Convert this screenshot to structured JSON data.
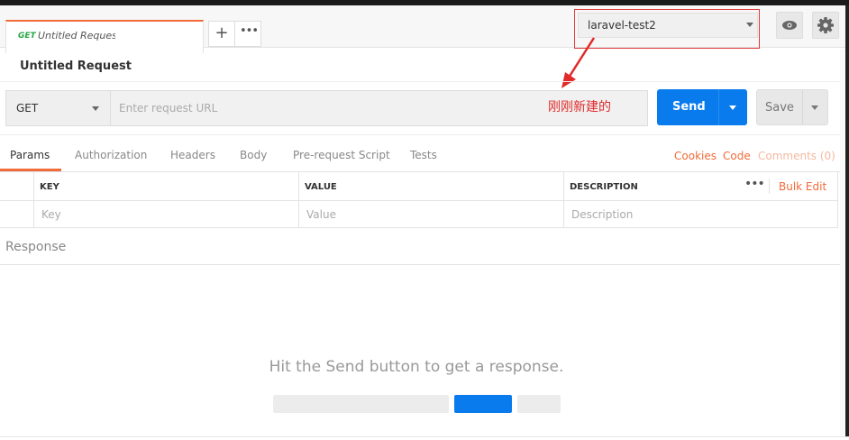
{
  "tab": {
    "method": "GET",
    "name": "Untitled Request"
  },
  "tab_controls": {
    "add": "+",
    "more": "•••"
  },
  "environment": {
    "selected": "laravel-test2"
  },
  "request": {
    "title": "Untitled Request",
    "method": "GET",
    "url_placeholder": "Enter request URL",
    "url_value": ""
  },
  "annotation": {
    "text": "刚刚新建的",
    "color": "#e12a2a"
  },
  "buttons": {
    "send": "Send",
    "save": "Save"
  },
  "request_tabs": [
    "Params",
    "Authorization",
    "Headers",
    "Body",
    "Pre-request Script",
    "Tests"
  ],
  "request_links": {
    "cookies": "Cookies",
    "code": "Code",
    "comments": "Comments (0)"
  },
  "params": {
    "headers": [
      "KEY",
      "VALUE",
      "DESCRIPTION"
    ],
    "placeholders": [
      "Key",
      "Value",
      "Description"
    ],
    "more": "•••",
    "bulk_edit": "Bulk Edit"
  },
  "response": {
    "label": "Response",
    "empty_message": "Hit the Send button to get a response."
  },
  "icons": [
    "eye-icon",
    "gear-icon",
    "plus-icon",
    "more-icon",
    "chevron-down-icon"
  ],
  "colors": {
    "accent": "#f26b3a",
    "primary": "#097bed",
    "get": "#28a745"
  }
}
